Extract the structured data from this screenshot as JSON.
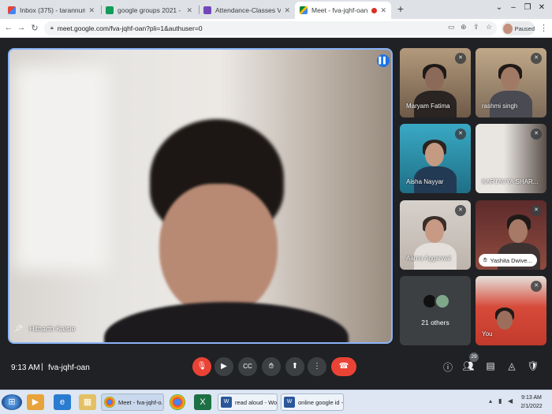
{
  "browser": {
    "tabs": [
      {
        "title": "Inbox (375) - tarannum@theindi",
        "icon": "gmail-icon"
      },
      {
        "title": "google groups 2021 - Google Sh",
        "icon": "sheets-icon"
      },
      {
        "title": "Attendance-Classes V TO VIII",
        "icon": "forms-icon"
      },
      {
        "title": "Meet - fva-jqhf-oan",
        "icon": "meet-icon"
      }
    ],
    "url": "meet.google.com/fva-jqhf-oan?pli=1&authuser=0",
    "profile_status": "Paused"
  },
  "meet": {
    "main_speaker": "Hitharth Kalsie",
    "participants": [
      {
        "name": "Maryam Fatima",
        "muted": true
      },
      {
        "name": "rashmi singh",
        "muted": true
      },
      {
        "name": "Aisha Nayyar",
        "muted": true
      },
      {
        "name": "KARTAVYA SHAR...",
        "muted": true
      },
      {
        "name": "Aarna Aggarwal",
        "muted": true
      },
      {
        "name": "Yashita Dwive...",
        "muted": true,
        "hand_raised": true
      },
      {
        "name": "You",
        "muted": true
      }
    ],
    "others_label": "21 others",
    "time": "9:13 AM",
    "separator": "|",
    "meeting_code": "fva-jqhf-oan",
    "people_count": "29"
  },
  "taskbar": {
    "windows": [
      {
        "label": "Meet - fva-jqhf-o...",
        "icon": "chrome-icon"
      },
      {
        "label": "read aloud - Word",
        "icon": "word-icon"
      },
      {
        "label": "online google id -...",
        "icon": "word-icon"
      }
    ],
    "time": "9:13 AM",
    "date": "2/1/2022"
  },
  "colors": {
    "accent_blue": "#8ab4f8",
    "end_call_red": "#ea4335",
    "meet_background": "#202124"
  }
}
